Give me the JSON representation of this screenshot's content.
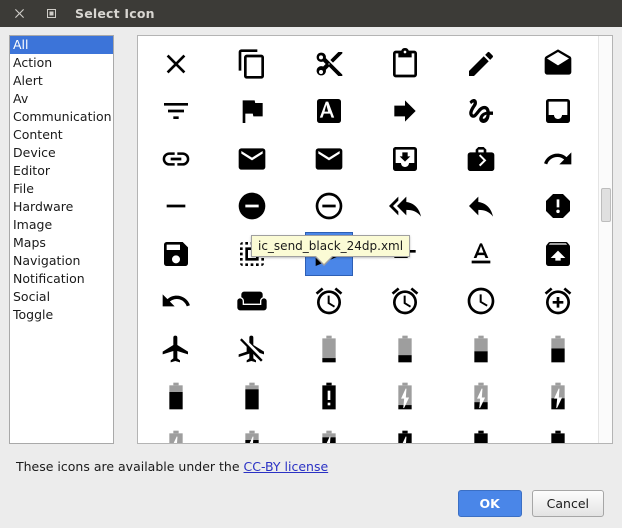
{
  "window": {
    "title": "Select Icon",
    "close_icon": "close-icon",
    "maximize_icon": "maximize-icon"
  },
  "colors": {
    "titlebar_bg": "#3c3b37",
    "selection_blue": "#3c74d9",
    "icon_selection_blue": "#4a86e8",
    "link_blue": "#2a31c4",
    "tooltip_bg": "#fbfbd5",
    "panel_bg": "#ececec"
  },
  "categories": {
    "selected": "All",
    "items": [
      {
        "label": "All"
      },
      {
        "label": "Action"
      },
      {
        "label": "Alert"
      },
      {
        "label": "Av"
      },
      {
        "label": "Communication"
      },
      {
        "label": "Content"
      },
      {
        "label": "Device"
      },
      {
        "label": "Editor"
      },
      {
        "label": "File"
      },
      {
        "label": "Hardware"
      },
      {
        "label": "Image"
      },
      {
        "label": "Maps"
      },
      {
        "label": "Navigation"
      },
      {
        "label": "Notification"
      },
      {
        "label": "Social"
      },
      {
        "label": "Toggle"
      }
    ]
  },
  "tooltip": {
    "text": "ic_send_black_24dp.xml"
  },
  "icon_grid": {
    "selected_index": 26,
    "columns": 6,
    "icons": [
      {
        "name": "close-icon"
      },
      {
        "name": "content-copy-icon"
      },
      {
        "name": "content-cut-icon"
      },
      {
        "name": "content-paste-icon"
      },
      {
        "name": "create-pencil-icon"
      },
      {
        "name": "drafts-icon"
      },
      {
        "name": "filter-list-icon"
      },
      {
        "name": "flag-icon"
      },
      {
        "name": "font-download-icon"
      },
      {
        "name": "forward-icon"
      },
      {
        "name": "gesture-icon"
      },
      {
        "name": "inbox-icon"
      },
      {
        "name": "link-icon"
      },
      {
        "name": "mail-icon"
      },
      {
        "name": "markunread-icon"
      },
      {
        "name": "move-to-inbox-icon"
      },
      {
        "name": "next-week-icon"
      },
      {
        "name": "redo-icon"
      },
      {
        "name": "remove-icon"
      },
      {
        "name": "remove-circle-icon"
      },
      {
        "name": "remove-circle-outline-icon"
      },
      {
        "name": "reply-all-icon"
      },
      {
        "name": "reply-icon"
      },
      {
        "name": "report-icon"
      },
      {
        "name": "save-icon"
      },
      {
        "name": "select-all-icon"
      },
      {
        "name": "send-icon"
      },
      {
        "name": "short-text-icon"
      },
      {
        "name": "text-format-icon"
      },
      {
        "name": "unarchive-icon"
      },
      {
        "name": "undo-icon"
      },
      {
        "name": "weekend-icon"
      },
      {
        "name": "access-alarm-icon"
      },
      {
        "name": "access-alarms-icon"
      },
      {
        "name": "access-time-icon"
      },
      {
        "name": "add-alarm-icon"
      },
      {
        "name": "airplanemode-active-icon"
      },
      {
        "name": "airplanemode-inactive-icon"
      },
      {
        "name": "battery-20-icon"
      },
      {
        "name": "battery-30-icon"
      },
      {
        "name": "battery-50-icon"
      },
      {
        "name": "battery-60-icon"
      },
      {
        "name": "battery-80-icon"
      },
      {
        "name": "battery-90-icon"
      },
      {
        "name": "battery-alert-icon"
      },
      {
        "name": "battery-charging-20-icon"
      },
      {
        "name": "battery-charging-30-icon"
      },
      {
        "name": "battery-charging-50-icon"
      },
      {
        "name": "battery-charging-60-icon"
      },
      {
        "name": "battery-charging-80-icon"
      },
      {
        "name": "battery-charging-90-icon"
      },
      {
        "name": "battery-charging-full-icon"
      },
      {
        "name": "battery-full-icon"
      },
      {
        "name": "battery-std-icon"
      }
    ]
  },
  "footer": {
    "license_text": "These icons are available under the",
    "license_link": "CC-BY license",
    "ok_label": "OK",
    "cancel_label": "Cancel"
  }
}
